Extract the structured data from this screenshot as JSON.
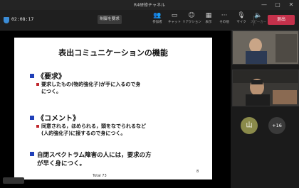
{
  "window": {
    "title": "R4研修チャネル"
  },
  "meeting": {
    "timer": "02:08:17",
    "control_button": "制御を要求",
    "leave_button": "退出"
  },
  "toolbar": [
    {
      "name": "people",
      "icon": "people-icon",
      "label": "参加者"
    },
    {
      "name": "chat",
      "icon": "chat-icon",
      "label": "チャット"
    },
    {
      "name": "reactions",
      "icon": "reaction-icon",
      "label": "リアクション"
    },
    {
      "name": "view",
      "icon": "grid-icon",
      "label": "表示"
    },
    {
      "name": "more",
      "icon": "more-icon",
      "label": "その他"
    },
    {
      "name": "mic",
      "icon": "mic-icon",
      "label": "マイク"
    },
    {
      "name": "speaker",
      "icon": "speaker-icon",
      "label": "スピーカー"
    }
  ],
  "slide": {
    "title": "表出コミュニケーションの機能",
    "sections": [
      {
        "heading": "《要求》",
        "text_lines": [
          "要求したもの(物的強化子)が手に入るので身",
          "につく。"
        ]
      },
      {
        "heading": "《コメント》",
        "text_lines": [
          "同意される，ほめられる，頭をなでられるなど",
          "(人的強化子)に接するので身につく。"
        ]
      },
      {
        "heading": "自閉スペクトラム障害の人には，要求の方",
        "heading2": "が早く身につく。"
      }
    ],
    "footer_left": "Total 73",
    "page": "8"
  },
  "participants": {
    "initial": "山",
    "more_count": "+16"
  }
}
